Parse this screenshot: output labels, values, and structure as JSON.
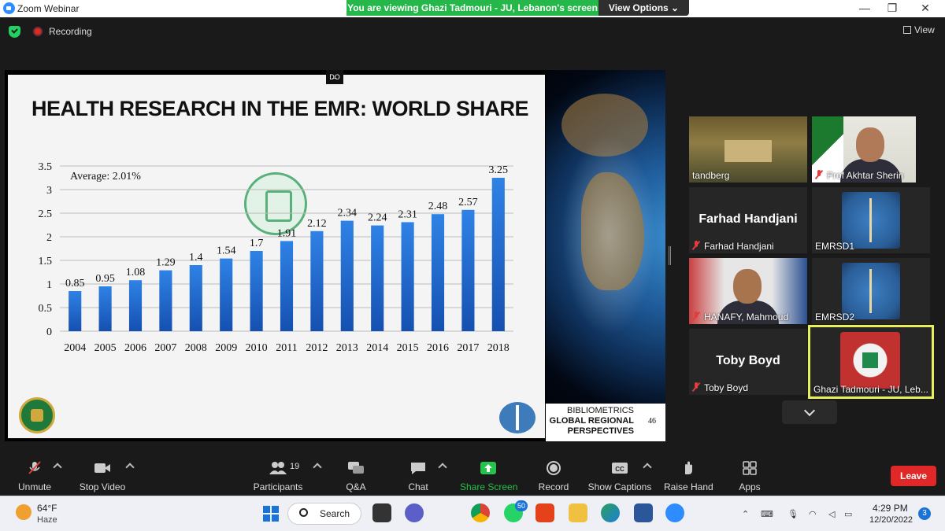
{
  "window": {
    "title": "Zoom Webinar",
    "minimize": "—",
    "restore": "❐",
    "close": "✕"
  },
  "banner": {
    "text": "You are viewing Ghazi Tadmouri - JU, Lebanon's screen",
    "view_options": "View Options ⌄"
  },
  "status": {
    "recording": "Recording",
    "view": "View"
  },
  "slide": {
    "title": "HEALTH RESEARCH IN THE EMR: WORLD SHARE",
    "average_label": "Average: 2.01%",
    "biblio_l1": "BIBLIOMETRICS",
    "biblio_l2": "GLOBAL REGIONAL",
    "biblio_l3": "PERSPECTIVES",
    "page_number": "46"
  },
  "chart_data": {
    "type": "bar",
    "categories": [
      "2004",
      "2005",
      "2006",
      "2007",
      "2008",
      "2009",
      "2010",
      "2011",
      "2012",
      "2013",
      "2014",
      "2015",
      "2016",
      "2017",
      "2018"
    ],
    "values": [
      0.85,
      0.95,
      1.08,
      1.29,
      1.4,
      1.54,
      1.7,
      1.91,
      2.12,
      2.34,
      2.24,
      2.31,
      2.48,
      2.57,
      3.25
    ],
    "value_labels": [
      "0.85",
      "0.95",
      "1.08",
      "1.29",
      "1.4",
      "1.54",
      "1.7",
      "1.91",
      "2.12",
      "2.34",
      "2.24",
      "2.31",
      "2.48",
      "2.57",
      "3.25"
    ],
    "y_ticks": [
      "0",
      "0.5",
      "1",
      "1.5",
      "2",
      "2.5",
      "3",
      "3.5"
    ],
    "ylim": [
      0,
      3.5
    ],
    "grid": true,
    "bar_color": "#1f6fd1",
    "title": "",
    "xlabel": "",
    "ylabel": ""
  },
  "gallery": {
    "tiles": [
      {
        "name": "tandberg"
      },
      {
        "name": "Prof Akhtar Sherin"
      },
      {
        "name": "Farhad Handjani",
        "big": "Farhad Handjani"
      },
      {
        "name": "EMRSD1"
      },
      {
        "name": "HANAFY, Mahmoud"
      },
      {
        "name": "EMRSD2"
      },
      {
        "name": "Toby Boyd",
        "big": "Toby Boyd"
      },
      {
        "name": "Ghazi Tadmouri - JU, Leb..."
      }
    ]
  },
  "toolbar": {
    "unmute": "Unmute",
    "stop_video": "Stop Video",
    "participants": "Participants",
    "participants_count": "19",
    "qa": "Q&A",
    "chat": "Chat",
    "share_screen": "Share Screen",
    "record": "Record",
    "show_captions": "Show Captions",
    "raise_hand": "Raise Hand",
    "apps": "Apps",
    "leave": "Leave",
    "accent": "#26c24c"
  },
  "taskbar": {
    "temperature": "64°F",
    "condition": "Haze",
    "search": "Search",
    "whatsapp_badge": "50",
    "time": "4:29 PM",
    "date": "12/20/2022",
    "notifications": "3"
  }
}
